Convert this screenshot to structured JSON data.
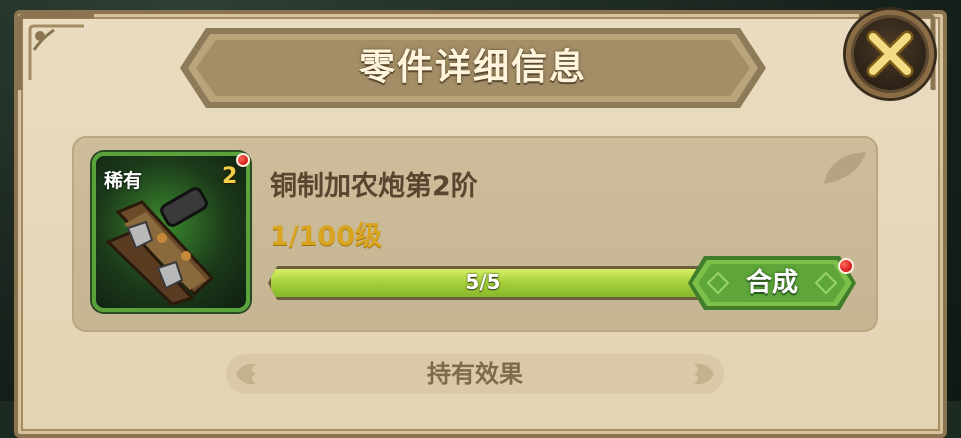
{
  "dialog": {
    "title": "零件详细信息",
    "close_icon": "close-x-icon"
  },
  "part": {
    "rarity": "稀有",
    "count": "2",
    "name": "铜制加农炮第2阶",
    "level": "1/100级",
    "icon": "bronze-cannon-icon",
    "progress": {
      "text": "5/5",
      "fraction": 1.0
    },
    "compose_label": "合成",
    "has_notification": true
  },
  "effect_section": {
    "label": "持有效果"
  },
  "colors": {
    "panel": "#e6d8bb",
    "rare_frame": "#5aa33c",
    "level_text": "#d9a521",
    "progress_fill": "#a9d23c",
    "notification": "#e02020"
  }
}
